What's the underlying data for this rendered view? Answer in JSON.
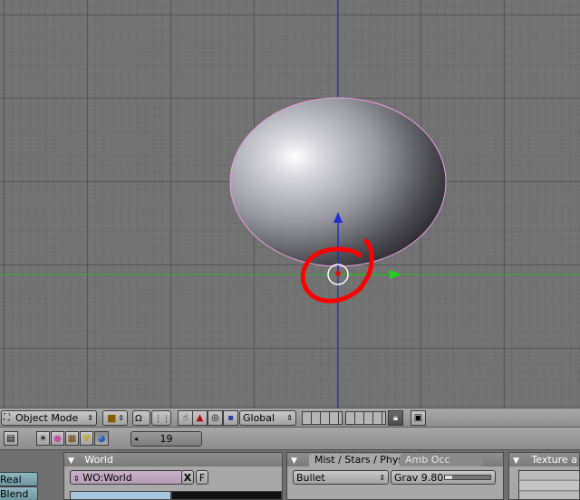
{
  "header": {
    "mode_label": "Object Mode",
    "orientation_label": "Global"
  },
  "buttons_window": {
    "frame_number": "19"
  },
  "panels": {
    "shading": {
      "real_label": "Real",
      "blend_label": "Blend"
    },
    "world": {
      "title": "World",
      "world_name": "WO:World",
      "x_label": "X",
      "f_label": "F"
    },
    "mist": {
      "tab_active": "Mist / Stars / Phys",
      "tab_inactive": "Amb Occ",
      "physics_engine": "Bullet",
      "gravity_label": "Grav 9.80",
      "gravity": 9.8
    },
    "texture": {
      "title": "Texture a"
    }
  },
  "colors": {
    "viewport_bg": "#737373",
    "x_axis": "#20c020",
    "z_axis": "#2030c0",
    "annotation": "#ff0000",
    "selection_outline": "#e8a0e0"
  }
}
